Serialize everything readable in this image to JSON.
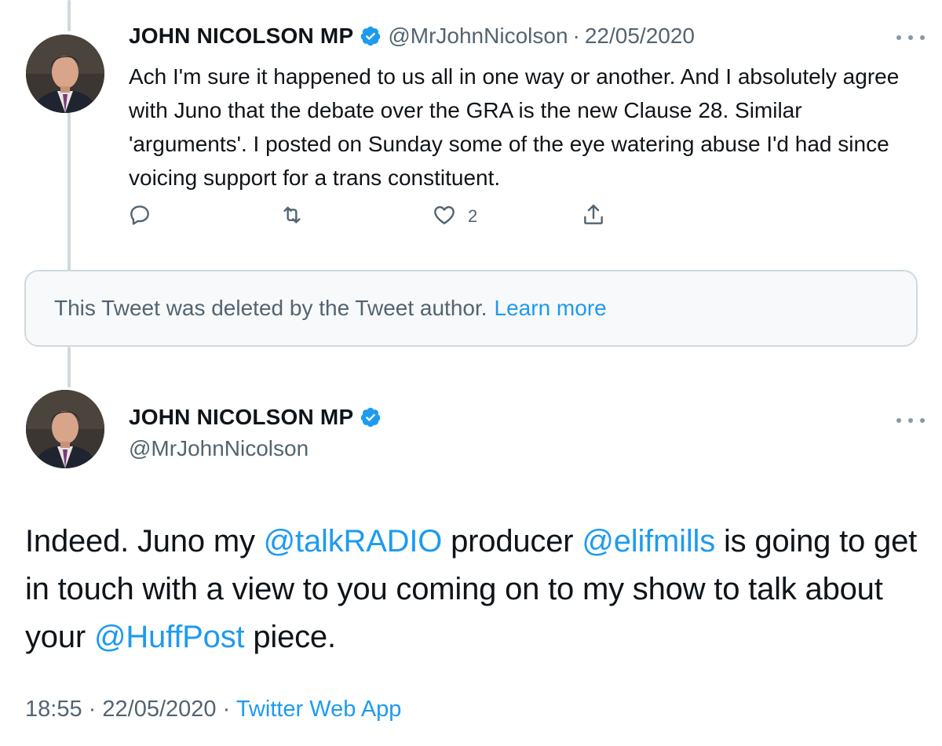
{
  "tweet1": {
    "name": "JOHN NICOLSON MP",
    "handle": "@MrJohnNicolson",
    "separator": "·",
    "date": "22/05/2020",
    "text": "Ach I'm sure it happened to us all in one way or another. And I absolutely agree with Juno that the debate over the GRA is the new Clause 28. Similar 'arguments'. I posted on Sunday some of the eye watering abuse I'd had since voicing support for a trans constituent.",
    "like_count": "2",
    "icons": [
      "reply-icon",
      "retweet-icon",
      "like-icon",
      "share-icon",
      "more-icon",
      "verified-badge-icon"
    ]
  },
  "deleted": {
    "message": "This Tweet was deleted by the Tweet author.",
    "link": "Learn more"
  },
  "tweet2": {
    "name": "JOHN NICOLSON MP",
    "handle": "@MrJohnNicolson",
    "text_parts": {
      "p1": "Indeed. Juno my ",
      "m1": "@talkRADIO",
      "p2": " producer ",
      "m2": "@elifmills",
      "p3": " is going to get in touch with a view to you coming on to my show to talk about your ",
      "m3": "@HuffPost",
      "p4": " piece."
    },
    "time": "18:55",
    "separator": "·",
    "date": "22/05/2020",
    "source": "Twitter Web App"
  },
  "colors": {
    "accent": "#1d9bf0",
    "secondary_text": "#536471",
    "border": "#cfd9de"
  }
}
